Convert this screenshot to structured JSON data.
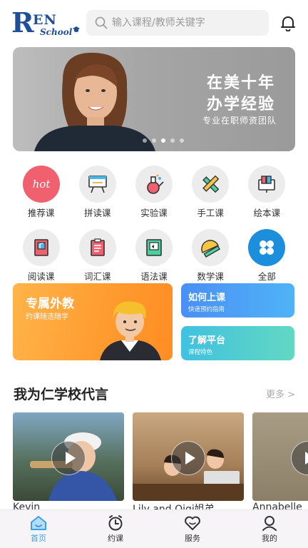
{
  "header": {
    "logo_text": "REN School",
    "search_placeholder": "输入课程/教师关键字",
    "icons": {
      "search": "search-icon",
      "notification": "bell-icon"
    }
  },
  "banner": {
    "line1": "在美十年",
    "line2": "办学经验",
    "line3": "专业在职师资团队",
    "slide_count": 5,
    "active_slide": 3
  },
  "categories": [
    {
      "label": "推荐课",
      "icon": "hot-icon"
    },
    {
      "label": "拼读课",
      "icon": "whiteboard-icon"
    },
    {
      "label": "实验课",
      "icon": "flask-icon"
    },
    {
      "label": "手工课",
      "icon": "pencil-ruler-icon"
    },
    {
      "label": "绘本课",
      "icon": "picture-book-icon"
    },
    {
      "label": "阅读课",
      "icon": "reading-book-icon"
    },
    {
      "label": "词汇课",
      "icon": "vocabulary-icon"
    },
    {
      "label": "语法课",
      "icon": "grammar-book-icon"
    },
    {
      "label": "数学课",
      "icon": "protractor-icon"
    },
    {
      "label": "全部",
      "icon": "all-grid-icon"
    }
  ],
  "promos": {
    "main": {
      "title": "专属外教",
      "subtitle": "约课随选随学"
    },
    "how": {
      "title": "如何上课",
      "subtitle": "快速预约指南"
    },
    "platform": {
      "title": "了解平台",
      "subtitle": "课程特色"
    }
  },
  "section": {
    "title": "我为仁学校代言",
    "more": "更多 >"
  },
  "videos": [
    {
      "name": "Kevin"
    },
    {
      "name": "Lily and Qiqi姐弟"
    },
    {
      "name": "Annabelle"
    }
  ],
  "tabbar": [
    {
      "label": "首页",
      "icon": "home-icon",
      "active": true
    },
    {
      "label": "约课",
      "icon": "clock-icon",
      "active": false
    },
    {
      "label": "服务",
      "icon": "heart-icon",
      "active": false
    },
    {
      "label": "我的",
      "icon": "user-icon",
      "active": false
    }
  ],
  "colors": {
    "brand": "#1f4f96",
    "accent": "#3aa0e8",
    "orange": "#ff9a2e",
    "active_category": "#f0606e"
  }
}
